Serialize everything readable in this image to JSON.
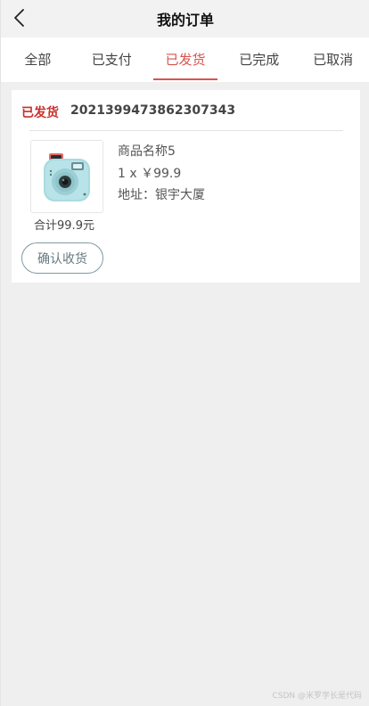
{
  "header": {
    "title": "我的订单",
    "back_icon": "chevron-left-icon"
  },
  "tabs": [
    {
      "label": "全部",
      "active": false
    },
    {
      "label": "已支付",
      "active": false
    },
    {
      "label": "已发货",
      "active": true
    },
    {
      "label": "已完成",
      "active": false
    },
    {
      "label": "已取消",
      "active": false
    }
  ],
  "order": {
    "status": "已发货",
    "number": "2021399473862307343",
    "product": {
      "image_icon": "instant-camera-product-image",
      "name": "商品名称5",
      "quantity_price": "1 x ￥99.9",
      "address": "地址：银宇大厦"
    },
    "total": "合计99.9元",
    "confirm_label": "确认收货"
  },
  "watermark": "CSDN @米罗学长是代码",
  "colors": {
    "accent": "#d9534f",
    "status": "#c9302c",
    "background": "#efefef",
    "button_border": "#7f9aa3"
  }
}
